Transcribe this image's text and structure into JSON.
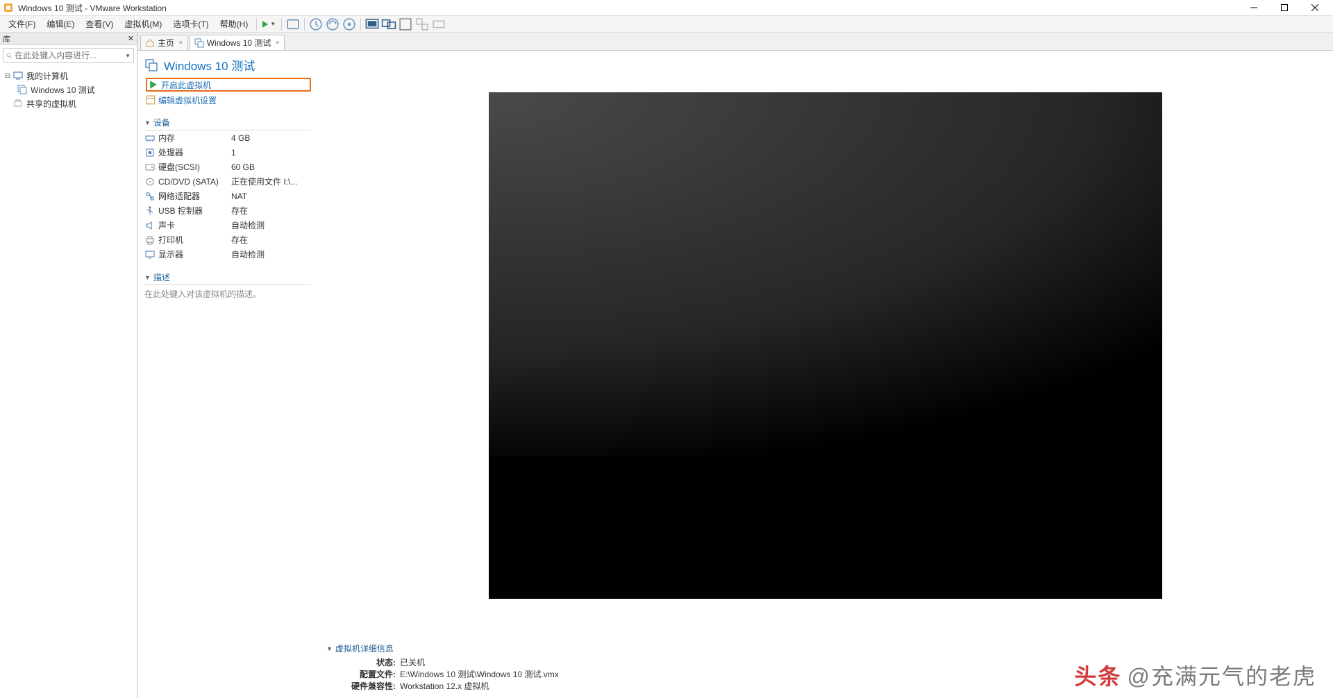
{
  "window": {
    "title": "Windows 10 测试 - VMware Workstation"
  },
  "menu": {
    "items": [
      "文件(F)",
      "编辑(E)",
      "查看(V)",
      "虚拟机(M)",
      "选项卡(T)",
      "帮助(H)"
    ]
  },
  "library": {
    "header": "库",
    "search_placeholder": "在此处键入内容进行...",
    "tree": {
      "root": "我的计算机",
      "child": "Windows 10 测试",
      "shared": "共享的虚拟机"
    }
  },
  "tabs": {
    "home": "主页",
    "vm": "Windows 10 测试"
  },
  "vm": {
    "name": "Windows 10 测试",
    "power_on": "开启此虚拟机",
    "edit_settings": "编辑虚拟机设置",
    "devices_header": "设备",
    "devices": [
      {
        "label": "内存",
        "value": "4 GB",
        "icon": "memory"
      },
      {
        "label": "处理器",
        "value": "1",
        "icon": "cpu"
      },
      {
        "label": "硬盘(SCSI)",
        "value": "60 GB",
        "icon": "disk"
      },
      {
        "label": "CD/DVD (SATA)",
        "value": "正在使用文件 I:\\...",
        "icon": "cd"
      },
      {
        "label": "网络适配器",
        "value": "NAT",
        "icon": "network"
      },
      {
        "label": "USB 控制器",
        "value": "存在",
        "icon": "usb"
      },
      {
        "label": "声卡",
        "value": "自动检测",
        "icon": "sound"
      },
      {
        "label": "打印机",
        "value": "存在",
        "icon": "printer"
      },
      {
        "label": "显示器",
        "value": "自动检测",
        "icon": "display"
      }
    ],
    "desc_header": "描述",
    "desc_placeholder": "在此处键入对该虚拟机的描述。",
    "details": {
      "header": "虚拟机详细信息",
      "rows": [
        {
          "k": "状态:",
          "v": "已关机"
        },
        {
          "k": "配置文件:",
          "v": "E:\\Windows 10 测试\\Windows 10 测试.vmx"
        },
        {
          "k": "硬件兼容性:",
          "v": "Workstation 12.x 虚拟机"
        }
      ]
    }
  },
  "watermark": {
    "brand": "头条",
    "author": "@充满元气的老虎"
  }
}
